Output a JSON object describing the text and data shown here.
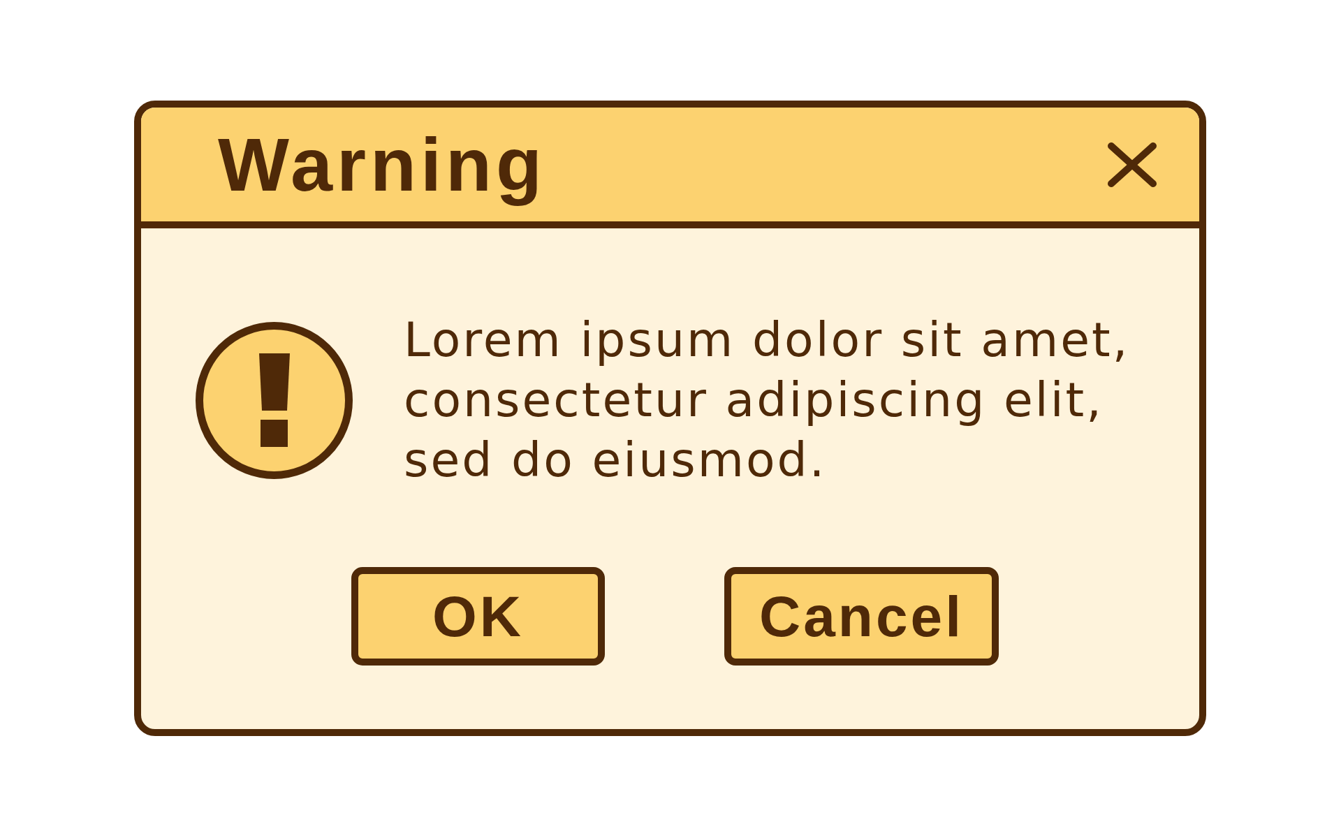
{
  "dialog": {
    "title": "Warning",
    "message": "Lorem ipsum dolor sit amet, consectetur adipiscing elit, sed do eiusmod.",
    "buttons": [
      {
        "label": "OK"
      },
      {
        "label": "Cancel"
      }
    ]
  }
}
